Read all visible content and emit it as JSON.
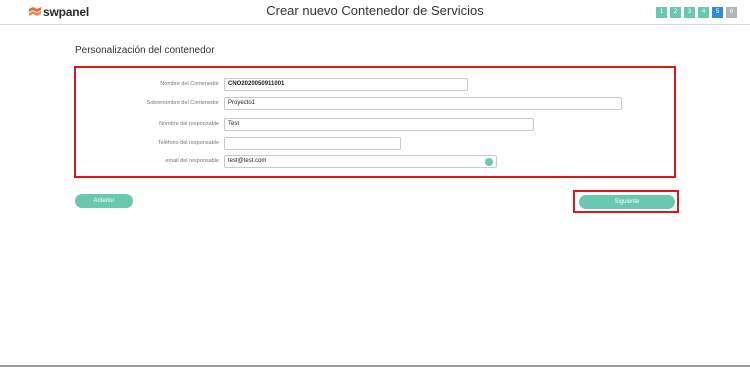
{
  "header": {
    "logo_text": "swpanel",
    "title": "Crear nuevo Contenedor de Servicios",
    "steps": [
      {
        "label": "1",
        "state": "done"
      },
      {
        "label": "2",
        "state": "done"
      },
      {
        "label": "3",
        "state": "done"
      },
      {
        "label": "4",
        "state": "done"
      },
      {
        "label": "5",
        "state": "active"
      },
      {
        "label": "6",
        "state": "inactive"
      }
    ]
  },
  "section_title": "Personalización del contenedor",
  "form": {
    "container_name": {
      "label": "Nombre del Contenedor",
      "value": "CNO2020050911001"
    },
    "container_nickname": {
      "label": "Sobrenombre del Contenedor",
      "value": "Proyecto1"
    },
    "responsible_name": {
      "label": "Nombre del responsable",
      "value": "Test"
    },
    "responsible_phone": {
      "label": "Teléfono del responsable",
      "value": ""
    },
    "responsible_email": {
      "label": "email del responsable",
      "value": "test@test.com"
    }
  },
  "buttons": {
    "previous": "Anterior",
    "next": "Siguiente"
  },
  "colors": {
    "accent": "#68c9b0",
    "active_step": "#2f8bd6",
    "highlight_border": "#e0161c",
    "inactive_step": "#b4b4b4"
  }
}
